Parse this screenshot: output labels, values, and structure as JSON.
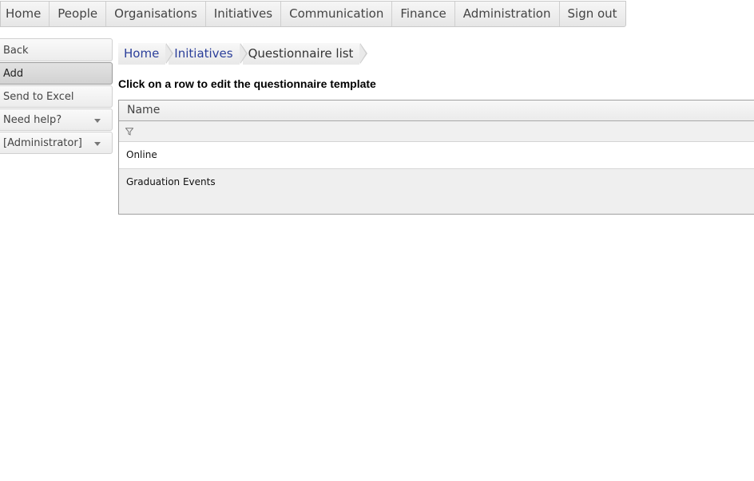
{
  "topnav": {
    "items": [
      {
        "label": "Home"
      },
      {
        "label": "People"
      },
      {
        "label": "Organisations"
      },
      {
        "label": "Initiatives"
      },
      {
        "label": "Communication"
      },
      {
        "label": "Finance"
      },
      {
        "label": "Administration"
      },
      {
        "label": "Sign out"
      }
    ]
  },
  "sidemenu": {
    "items": [
      {
        "label": "Back"
      },
      {
        "label": "Add"
      },
      {
        "label": "Send to Excel"
      },
      {
        "label": "Need help?"
      },
      {
        "label": "[Administrator]"
      }
    ]
  },
  "breadcrumb": {
    "items": [
      {
        "label": "Home"
      },
      {
        "label": "Initiatives"
      },
      {
        "label": "Questionnaire list"
      }
    ]
  },
  "instruction": "Click on a row to edit the questionnaire template",
  "grid": {
    "columns": [
      {
        "header": "Name"
      }
    ],
    "rows": [
      {
        "name": "Online"
      },
      {
        "name": "Graduation Events"
      }
    ]
  },
  "colors": {
    "link": "#2b3f9a",
    "border": "#a0a0a0",
    "active_menu": "#d2d2d2"
  }
}
